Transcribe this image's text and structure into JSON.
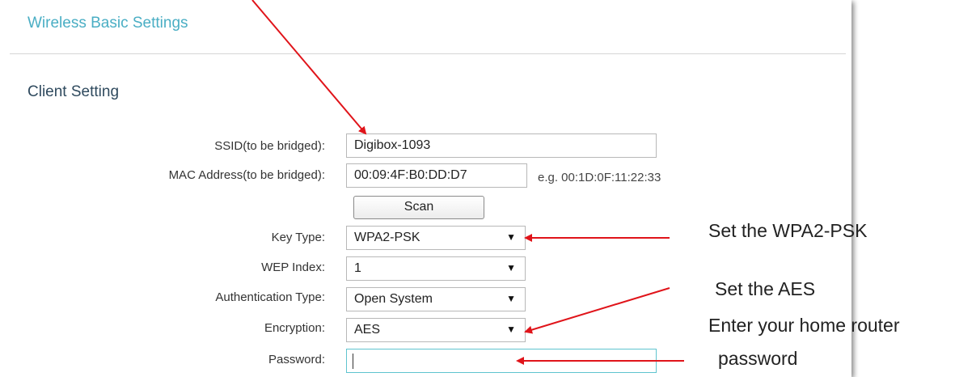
{
  "page": {
    "title": "Wireless Basic Settings",
    "section_title": "Client Setting"
  },
  "form": {
    "ssid": {
      "label": "SSID(to be bridged):",
      "value": "Digibox-1093"
    },
    "mac": {
      "label": "MAC Address(to be bridged):",
      "value": "00:09:4F:B0:DD:D7",
      "hint": "e.g. 00:1D:0F:11:22:33"
    },
    "scan_label": "Scan",
    "key_type": {
      "label": "Key Type:",
      "value": "WPA2-PSK"
    },
    "wep_index": {
      "label": "WEP Index:",
      "value": "1"
    },
    "auth_type": {
      "label": "Authentication Type:",
      "value": "Open System"
    },
    "encryption": {
      "label": "Encryption:",
      "value": "AES"
    },
    "password": {
      "label": "Password:",
      "value": ""
    }
  },
  "annotations": {
    "set_wpa2": "Set the WPA2-PSK",
    "set_aes": "Set the AES",
    "enter_password_line1": "Enter your home router",
    "enter_password_line2": "password",
    "arrow_color": "#e0141a"
  },
  "icons": {
    "dropdown": "caret-down-icon"
  }
}
